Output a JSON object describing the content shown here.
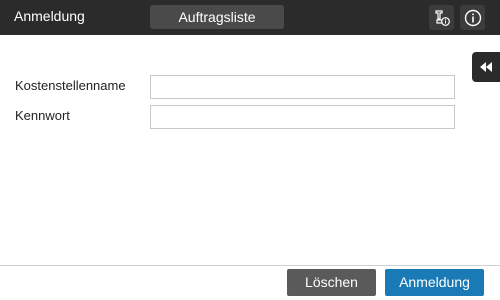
{
  "header": {
    "screen_title": "Anmeldung",
    "job_list_tab": "Auftragsliste",
    "device_info_icon": "device-info-icon",
    "help_icon": "info-icon"
  },
  "side_panel": {
    "icon": "double-chevron-left-icon"
  },
  "form": {
    "cost_center_label": "Kostenstellenname",
    "cost_center_value": "",
    "password_label": "Kennwort",
    "password_value": ""
  },
  "footer": {
    "clear_label": "Löschen",
    "login_label": "Anmeldung"
  },
  "colors": {
    "topbar": "#2b2b2b",
    "primary_button": "#1a7ab5",
    "secondary_button": "#5a5a5a"
  }
}
